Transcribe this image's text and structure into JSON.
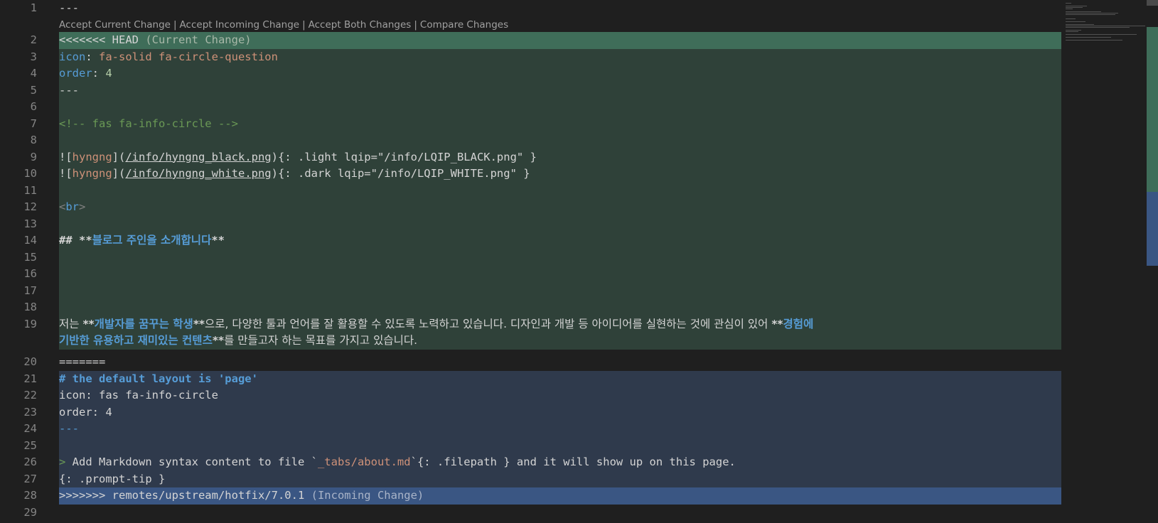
{
  "codelens": {
    "accept_current": "Accept Current Change",
    "accept_incoming": "Accept Incoming Change",
    "accept_both": "Accept Both Changes",
    "compare": "Compare Changes",
    "separator": "|"
  },
  "lines": {
    "l1": {
      "num": "1",
      "text": "---"
    },
    "l2": {
      "num": "2",
      "marker": "<<<<<<< HEAD",
      "label": "(Current Change)"
    },
    "l3": {
      "num": "3",
      "key": "icon",
      "colon": ": ",
      "value": "fa-solid fa-circle-question"
    },
    "l4": {
      "num": "4",
      "key": "order",
      "colon": ": ",
      "value": "4"
    },
    "l5": {
      "num": "5",
      "text": "---"
    },
    "l6": {
      "num": "6"
    },
    "l7": {
      "num": "7",
      "comment": "<!-- fas fa-info-circle -->"
    },
    "l8": {
      "num": "8"
    },
    "l9": {
      "num": "9",
      "p1": "![",
      "alt": "hyngng",
      "p2": "](",
      "url": "/info/hyngng_black.png",
      "p3": "){: .light lqip=\"/info/LQIP_BLACK.png\" }"
    },
    "l10": {
      "num": "10",
      "p1": "![",
      "alt": "hyngng",
      "p2": "](",
      "url": "/info/hyngng_white.png",
      "p3": "){: .dark lqip=\"/info/LQIP_WHITE.png\" }"
    },
    "l11": {
      "num": "11"
    },
    "l12": {
      "num": "12",
      "lt": "<",
      "tag": "br",
      "gt": ">"
    },
    "l13": {
      "num": "13"
    },
    "l14": {
      "num": "14",
      "hash": "## ",
      "stars1": "**",
      "bold": "블로그 주인을 소개합니다",
      "stars2": "**"
    },
    "l15": {
      "num": "15"
    },
    "l16": {
      "num": "16"
    },
    "l17": {
      "num": "17"
    },
    "l18": {
      "num": "18"
    },
    "l19": {
      "num": "19",
      "a": "저는 ",
      "s1": "**",
      "b1": "개발자를 꿈꾸는 학생",
      "s2": "**",
      "c": "으로, 다양한 툴과 언어를 잘 활용할 수 있도록 노력하고 있습니다. 디자인과 개발 등 아이디어를 실현하는 것에 관심이 있어 ",
      "s3": "**",
      "b2a": "경험에",
      "b2b": "기반한 유용하고 재미있는 컨텐츠",
      "s4": "**",
      "d": "를 만들고자 하는 목표를 가지고 있습니다."
    },
    "l20": {
      "num": "20",
      "text": "======="
    },
    "l21": {
      "num": "21",
      "text": "# the default layout is 'page'"
    },
    "l22": {
      "num": "22",
      "text": "icon: fas fa-info-circle"
    },
    "l23": {
      "num": "23",
      "text": "order: 4"
    },
    "l24": {
      "num": "24",
      "text": "---"
    },
    "l25": {
      "num": "25"
    },
    "l26": {
      "num": "26",
      "gt": "> ",
      "a": "Add Markdown syntax content to file `",
      "code": "_tabs/about.md",
      "b": "`{: .filepath } and it will show up on this page."
    },
    "l27": {
      "num": "27",
      "text": "{: .prompt-tip }"
    },
    "l28": {
      "num": "28",
      "marker": ">>>>>>> remotes/upstream/hotfix/7.0.1",
      "label": "(Incoming Change)"
    },
    "l29": {
      "num": "29"
    }
  },
  "colors": {
    "editor_bg": "#1f1f1f",
    "current_change_bg": "#2f4139",
    "current_header_bg": "#3f6d59",
    "incoming_change_bg": "#2f3a4c",
    "incoming_header_bg": "#3a5683",
    "keyword": "#569cd6",
    "string": "#ce9178",
    "comment": "#6a9955"
  }
}
